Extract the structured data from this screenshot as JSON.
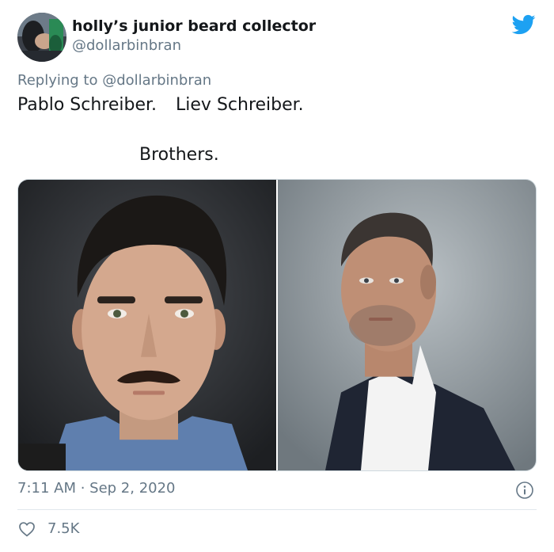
{
  "tweet": {
    "display_name": "holly’s junior beard collector",
    "handle": "@dollarbinbran",
    "replying_prefix": "Replying to",
    "replying_to": "@dollarbinbran",
    "text_line1_a": "Pablo Schreiber.",
    "text_line1_b": "Liev Schreiber.",
    "text_line2": "Brothers.",
    "timestamp": "7:11 AM · Sep 2, 2020",
    "like_count": "7.5K"
  },
  "icons": {
    "brand": "twitter-bird-icon",
    "info": "info-icon",
    "like": "heart-icon"
  },
  "colors": {
    "twitter_blue": "#1da1f2",
    "text_primary": "#14171a",
    "text_secondary": "#657786",
    "divider": "#e1e8ed"
  }
}
